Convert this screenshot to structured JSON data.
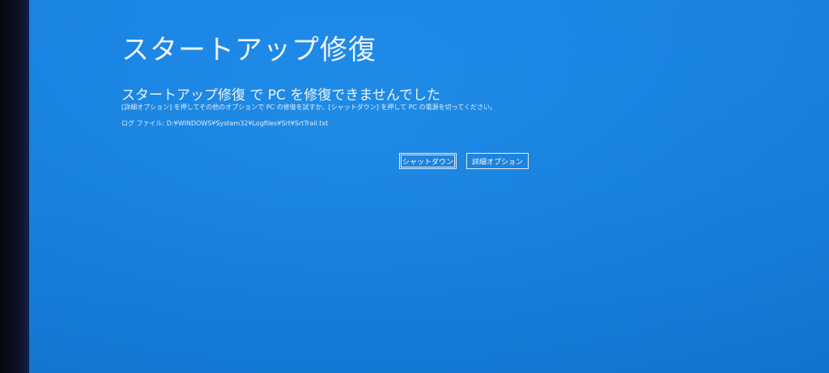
{
  "screen": {
    "title": "スタートアップ修復",
    "message": "スタートアップ修復 で PC を修復できませんでした",
    "detail": "[詳細オプション] を押してその他のオプションで PC の修復を試すか、[シャットダウン] を押して PC の電源を切ってください。",
    "log_file": "ログ ファイル: D:¥WINDOWS¥System32¥Logfiles¥Srt¥SrtTrail.txt"
  },
  "buttons": {
    "shutdown": "シャットダウン",
    "advanced_options": "詳細オプション"
  },
  "colors": {
    "background": "#1583e4",
    "text": "#eef5fd",
    "button_border": "#e8f1fc"
  }
}
